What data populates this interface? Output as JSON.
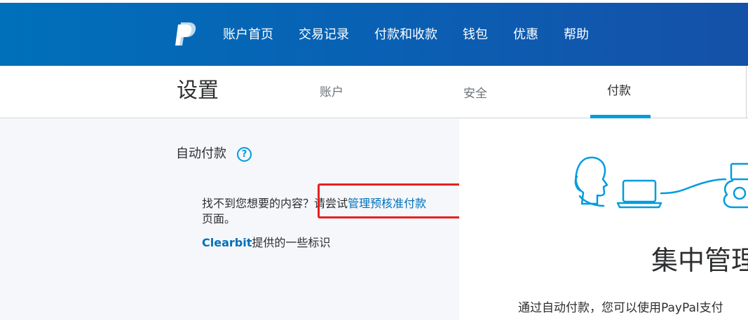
{
  "nav": {
    "items": [
      "账户首页",
      "交易记录",
      "付款和收款",
      "钱包",
      "优惠",
      "帮助"
    ]
  },
  "settings": {
    "title": "设置",
    "tabs": {
      "account": "账户",
      "security": "安全",
      "payments": "付款"
    },
    "active_tab": "付款"
  },
  "autopay": {
    "title": "自动付款",
    "help_icon": "?",
    "message_prefix": "找不到您想要的内容？请尝试",
    "message_link": "管理预核准付款",
    "message_suffix": "页面。",
    "clearbit_brand": "Clearbit",
    "clearbit_text": "提供的一些标识"
  },
  "hero": {
    "title": "集中管理",
    "text": "通过自动付款，您可以使用PayPal支付"
  },
  "colors": {
    "brand_blue": "#0070ba",
    "accent_blue": "#009cde",
    "highlight_red": "#e8201e",
    "panel_gray": "#f5f7fa"
  },
  "icons": [
    "paypal-logo-icon",
    "help-icon",
    "autopay-illustration"
  ]
}
